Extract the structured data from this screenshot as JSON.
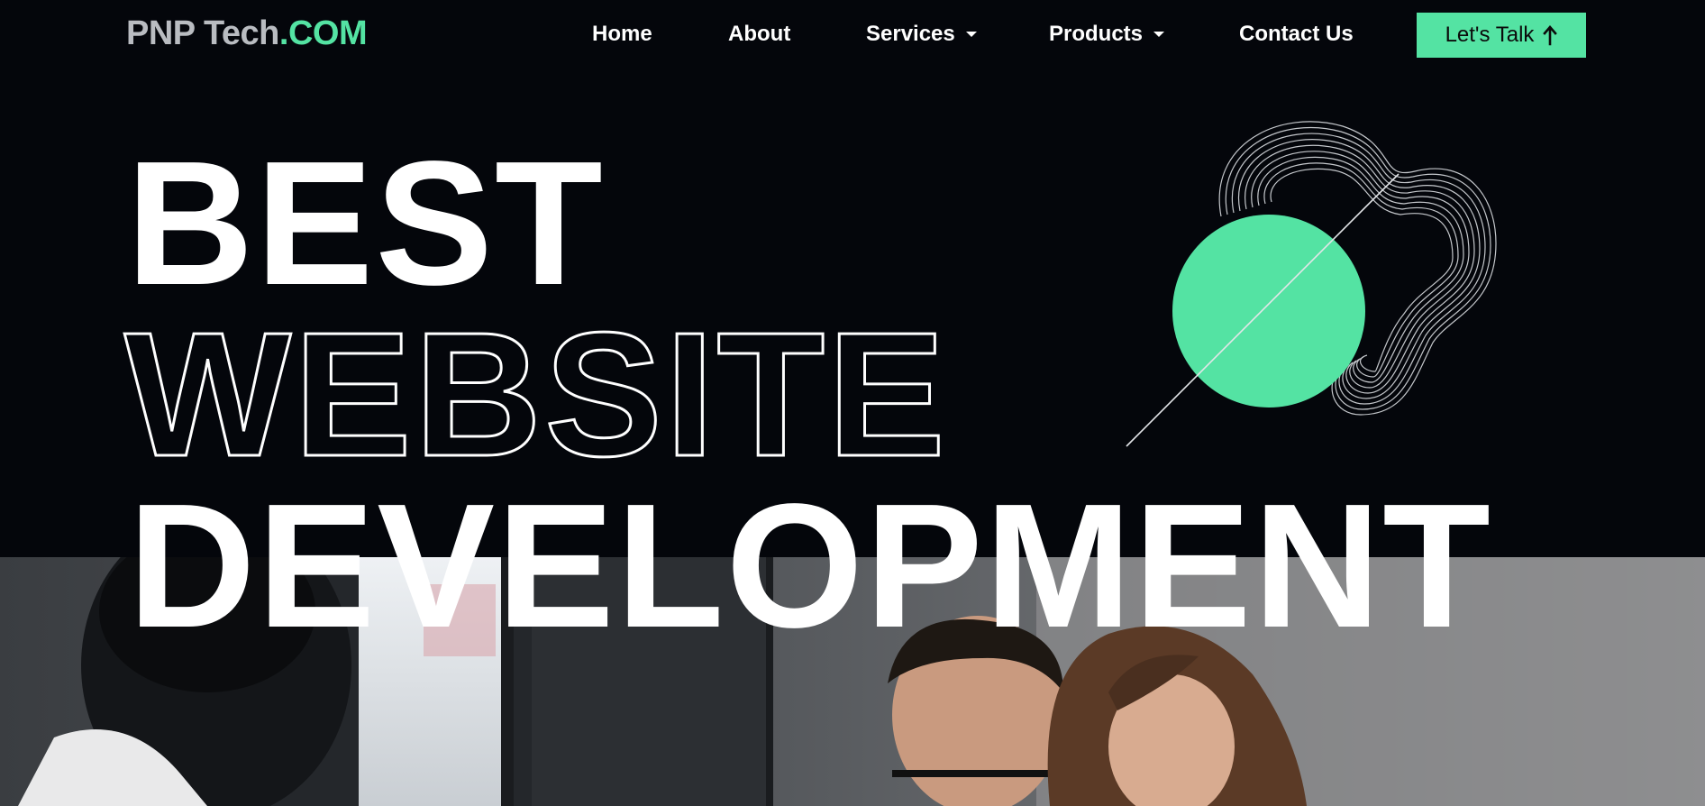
{
  "nav": {
    "brand_main": "PNP Tech",
    "brand_tld": ".COM",
    "items": [
      {
        "label": "Home"
      },
      {
        "label": "About"
      },
      {
        "label": "Services"
      },
      {
        "label": "Products"
      },
      {
        "label": "Contact Us"
      }
    ],
    "cta_label": "Let's Talk",
    "cta_icon": "arrow-up-icon"
  },
  "hero": {
    "line_1": "BEST",
    "line_2": "WEBSITE",
    "line_3": "DEVELOPMENT"
  },
  "colors": {
    "background": "#04060b",
    "accent": "#54e3a3",
    "text": "#ffffff",
    "brand_grey": "#b9bcc1"
  },
  "icons": {
    "decor": "wavy-lines-with-green-circle",
    "photo": "team-meeting-photo"
  }
}
